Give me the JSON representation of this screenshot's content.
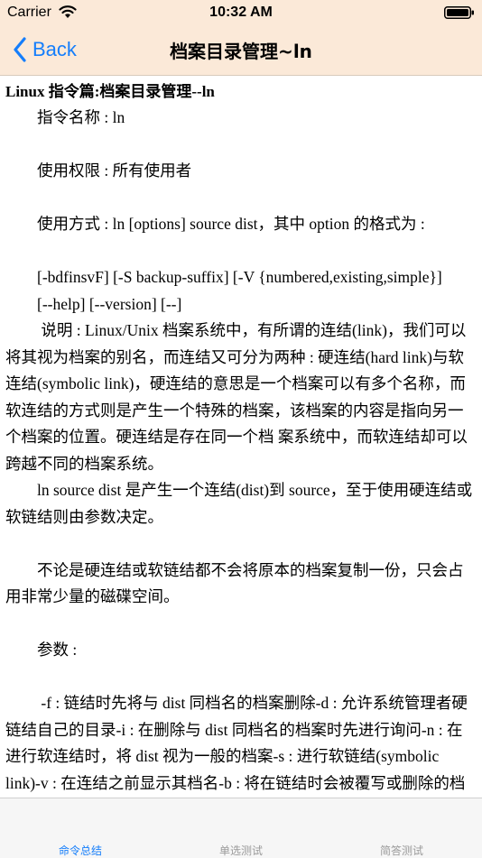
{
  "status_bar": {
    "carrier": "Carrier",
    "time": "10:32 AM",
    "wifi_icon": "wifi-icon",
    "battery_icon": "battery-icon"
  },
  "nav": {
    "back_label": "Back",
    "title": "档案目录管理~ln",
    "accent_color": "#157efb",
    "background_color": "#fbe9d8"
  },
  "document": {
    "title": "Linux 指令篇:档案目录管理--ln",
    "paragraphs": [
      "        指令名称 : ln",
      "",
      "        使用权限 : 所有使用者",
      "",
      "        使用方式 : ln [options] source dist，其中 option 的格式为 :",
      "",
      "        [-bdfinsvF] [-S backup-suffix] [-V {numbered,existing,simple}]",
      "        [--help] [--version] [--]",
      "         说明 : Linux/Unix 档案系统中，有所谓的连结(link)，我们可以将其视为档案的别名，而连结又可分为两种 : 硬连结(hard link)与软连结(symbolic link)，硬连结的意思是一个档案可以有多个名称，而软连结的方式则是产生一个特殊的档案，该档案的内容是指向另一个档案的位置。硬连结是存在同一个档 案系统中，而软连结却可以跨越不同的档案系统。",
      "        ln source dist 是产生一个连结(dist)到 source，至于使用硬连结或软链结则由参数决定。",
      "",
      "        不论是硬连结或软链结都不会将原本的档案复制一份，只会占用非常少量的磁碟空间。",
      "",
      "        参数 :",
      "",
      "         -f : 链结时先将与 dist 同档名的档案删除-d : 允许系统管理者硬链结自己的目录-i : 在删除与 dist 同档名的档案时先进行询问-n : 在进行软连结时，将 dist 视为一般的档案-s : 进行软链结(symbolic link)-v : 在连结之前显示其档名-b : 将在链结时会被覆写或删除的档案进行备份"
    ]
  },
  "tabbar": {
    "tabs": [
      {
        "label": "命令总结",
        "active": true
      },
      {
        "label": "单选测试",
        "active": false
      },
      {
        "label": "简答测试",
        "active": false
      }
    ]
  }
}
